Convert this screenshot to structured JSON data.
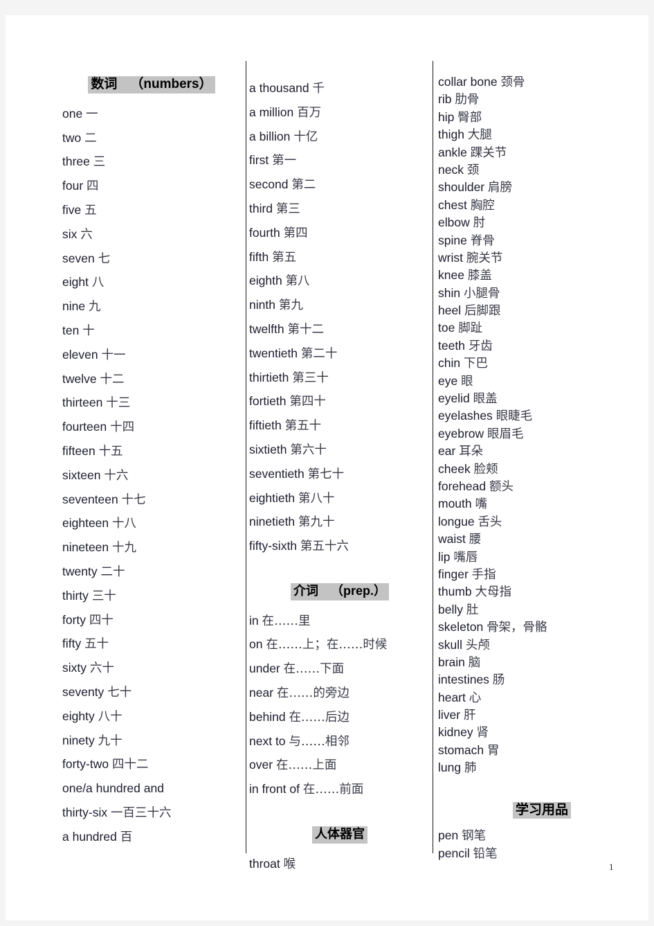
{
  "page": {
    "page_number": "1",
    "highlight_color": "#c3c3c3",
    "text_color": "#1c1c2e",
    "background_color": "#f4f4f4",
    "paper_color": "#ffffff"
  },
  "columns": [
    {
      "id": "column-1",
      "blocks": [
        {
          "type": "heading",
          "cn": "数词",
          "en": "（numbers）"
        },
        {
          "type": "entries",
          "items": [
            {
              "en": "one",
              "cn": "一"
            },
            {
              "en": "two",
              "cn": "二"
            },
            {
              "en": "three",
              "cn": "三"
            },
            {
              "en": "four",
              "cn": "四"
            },
            {
              "en": "five",
              "cn": "五"
            },
            {
              "en": "six",
              "cn": "六"
            },
            {
              "en": "seven",
              "cn": "七"
            },
            {
              "en": "eight",
              "cn": "八"
            },
            {
              "en": "nine",
              "cn": "九"
            },
            {
              "en": "ten",
              "cn": "十"
            },
            {
              "en": "eleven",
              "cn": "十一"
            },
            {
              "en": "twelve",
              "cn": "十二"
            },
            {
              "en": "thirteen",
              "cn": "十三"
            },
            {
              "en": "fourteen",
              "cn": "十四"
            },
            {
              "en": "fifteen",
              "cn": "十五"
            },
            {
              "en": "sixteen",
              "cn": "十六"
            },
            {
              "en": "seventeen",
              "cn": "十七"
            },
            {
              "en": "eighteen",
              "cn": "十八"
            },
            {
              "en": "nineteen",
              "cn": "十九"
            },
            {
              "en": "twenty",
              "cn": "二十"
            },
            {
              "en": "thirty",
              "cn": "三十"
            },
            {
              "en": "forty",
              "cn": "四十"
            },
            {
              "en": "fifty",
              "cn": "五十"
            },
            {
              "en": "sixty",
              "cn": "六十"
            },
            {
              "en": "seventy",
              "cn": "七十"
            },
            {
              "en": "eighty",
              "cn": "八十"
            },
            {
              "en": "ninety",
              "cn": "九十"
            },
            {
              "en": "forty-two",
              "cn": "四十二"
            },
            {
              "en": "one/a hundred and",
              "cn": ""
            },
            {
              "en": "thirty-six",
              "cn": "一百三十六"
            },
            {
              "en": "a hundred",
              "cn": "百"
            }
          ]
        }
      ]
    },
    {
      "id": "column-2",
      "blocks": [
        {
          "type": "entries",
          "items": [
            {
              "en": "a thousand",
              "cn": "千"
            },
            {
              "en": "a million",
              "cn": "百万"
            },
            {
              "en": "a billion",
              "cn": "十亿"
            },
            {
              "en": "first",
              "cn": "第一"
            },
            {
              "en": "second",
              "cn": "第二"
            },
            {
              "en": "third",
              "cn": "第三"
            },
            {
              "en": "fourth",
              "cn": "第四"
            },
            {
              "en": "fifth",
              "cn": "第五"
            },
            {
              "en": "eighth",
              "cn": "第八"
            },
            {
              "en": "ninth",
              "cn": "第九"
            },
            {
              "en": "twelfth",
              "cn": "第十二"
            },
            {
              "en": "twentieth",
              "cn": "第二十"
            },
            {
              "en": "thirtieth",
              "cn": "第三十"
            },
            {
              "en": "fortieth",
              "cn": "第四十"
            },
            {
              "en": "fiftieth",
              "cn": "第五十"
            },
            {
              "en": "sixtieth",
              "cn": "第六十"
            },
            {
              "en": "seventieth",
              "cn": "第七十"
            },
            {
              "en": "eightieth",
              "cn": "第八十"
            },
            {
              "en": "ninetieth",
              "cn": "第九十"
            },
            {
              "en": "fifty-sixth",
              "cn": "第五十六"
            }
          ]
        },
        {
          "type": "heading",
          "cn": "介词",
          "en": "（prep.）"
        },
        {
          "type": "entries",
          "items": [
            {
              "en": "in",
              "cn": "在……里"
            },
            {
              "en": "on",
              "cn": "在……上；在……时候"
            },
            {
              "en": "under",
              "cn": "在……下面"
            },
            {
              "en": "near",
              "cn": "在……的旁边"
            },
            {
              "en": "behind",
              "cn": "在……后边"
            },
            {
              "en": "next to",
              "cn": "与……相邻"
            },
            {
              "en": "over",
              "cn": "在……上面"
            },
            {
              "en": "in front of",
              "cn": "在……前面"
            }
          ]
        },
        {
          "type": "heading",
          "cn": "人体器官",
          "en": ""
        },
        {
          "type": "entries",
          "items": [
            {
              "en": "throat",
              "cn": "喉"
            }
          ]
        }
      ]
    },
    {
      "id": "column-3",
      "blocks": [
        {
          "type": "entries",
          "items": [
            {
              "en": "collar bone",
              "cn": "颈骨"
            },
            {
              "en": "rib",
              "cn": "肋骨"
            },
            {
              "en": "hip",
              "cn": "臀部"
            },
            {
              "en": "thigh",
              "cn": "大腿"
            },
            {
              "en": "ankle",
              "cn": "踝关节"
            },
            {
              "en": "neck",
              "cn": "颈"
            },
            {
              "en": "shoulder",
              "cn": "肩膀"
            },
            {
              "en": "chest",
              "cn": "胸腔"
            },
            {
              "en": "elbow",
              "cn": "肘"
            },
            {
              "en": "spine",
              "cn": "脊骨"
            },
            {
              "en": "wrist",
              "cn": "腕关节"
            },
            {
              "en": "knee",
              "cn": "膝盖"
            },
            {
              "en": "shin",
              "cn": "小腿骨"
            },
            {
              "en": "heel",
              "cn": "后脚跟"
            },
            {
              "en": "toe",
              "cn": "脚趾"
            },
            {
              "en": "teeth",
              "cn": "牙齿"
            },
            {
              "en": "chin",
              "cn": "下巴"
            },
            {
              "en": "eye",
              "cn": "眼"
            },
            {
              "en": "eyelid",
              "cn": "眼盖"
            },
            {
              "en": "eyelashes",
              "cn": "眼睫毛"
            },
            {
              "en": "eyebrow",
              "cn": "眼眉毛"
            },
            {
              "en": "ear",
              "cn": "耳朵"
            },
            {
              "en": "cheek",
              "cn": "脸颊"
            },
            {
              "en": "forehead",
              "cn": "额头"
            },
            {
              "en": "mouth",
              "cn": "嘴"
            },
            {
              "en": "longue",
              "cn": "舌头"
            },
            {
              "en": "waist",
              "cn": "腰"
            },
            {
              "en": "lip",
              "cn": "嘴唇"
            },
            {
              "en": "finger",
              "cn": "手指"
            },
            {
              "en": "thumb",
              "cn": "大母指"
            },
            {
              "en": "belly",
              "cn": "肚"
            },
            {
              "en": "skeleton",
              "cn": "骨架，骨骼"
            },
            {
              "en": "skull",
              "cn": "头颅"
            },
            {
              "en": "brain",
              "cn": "脑"
            },
            {
              "en": "intestines",
              "cn": "肠"
            },
            {
              "en": "heart",
              "cn": "心"
            },
            {
              "en": "liver",
              "cn": "肝"
            },
            {
              "en": "kidney",
              "cn": "肾"
            },
            {
              "en": "stomach",
              "cn": "胃"
            },
            {
              "en": "lung",
              "cn": "肺"
            }
          ]
        },
        {
          "type": "heading",
          "cn": "学习用品",
          "en": ""
        },
        {
          "type": "entries",
          "items": [
            {
              "en": "pen",
              "cn": "钢笔"
            },
            {
              "en": "pencil",
              "cn": "铅笔"
            }
          ]
        }
      ]
    }
  ]
}
